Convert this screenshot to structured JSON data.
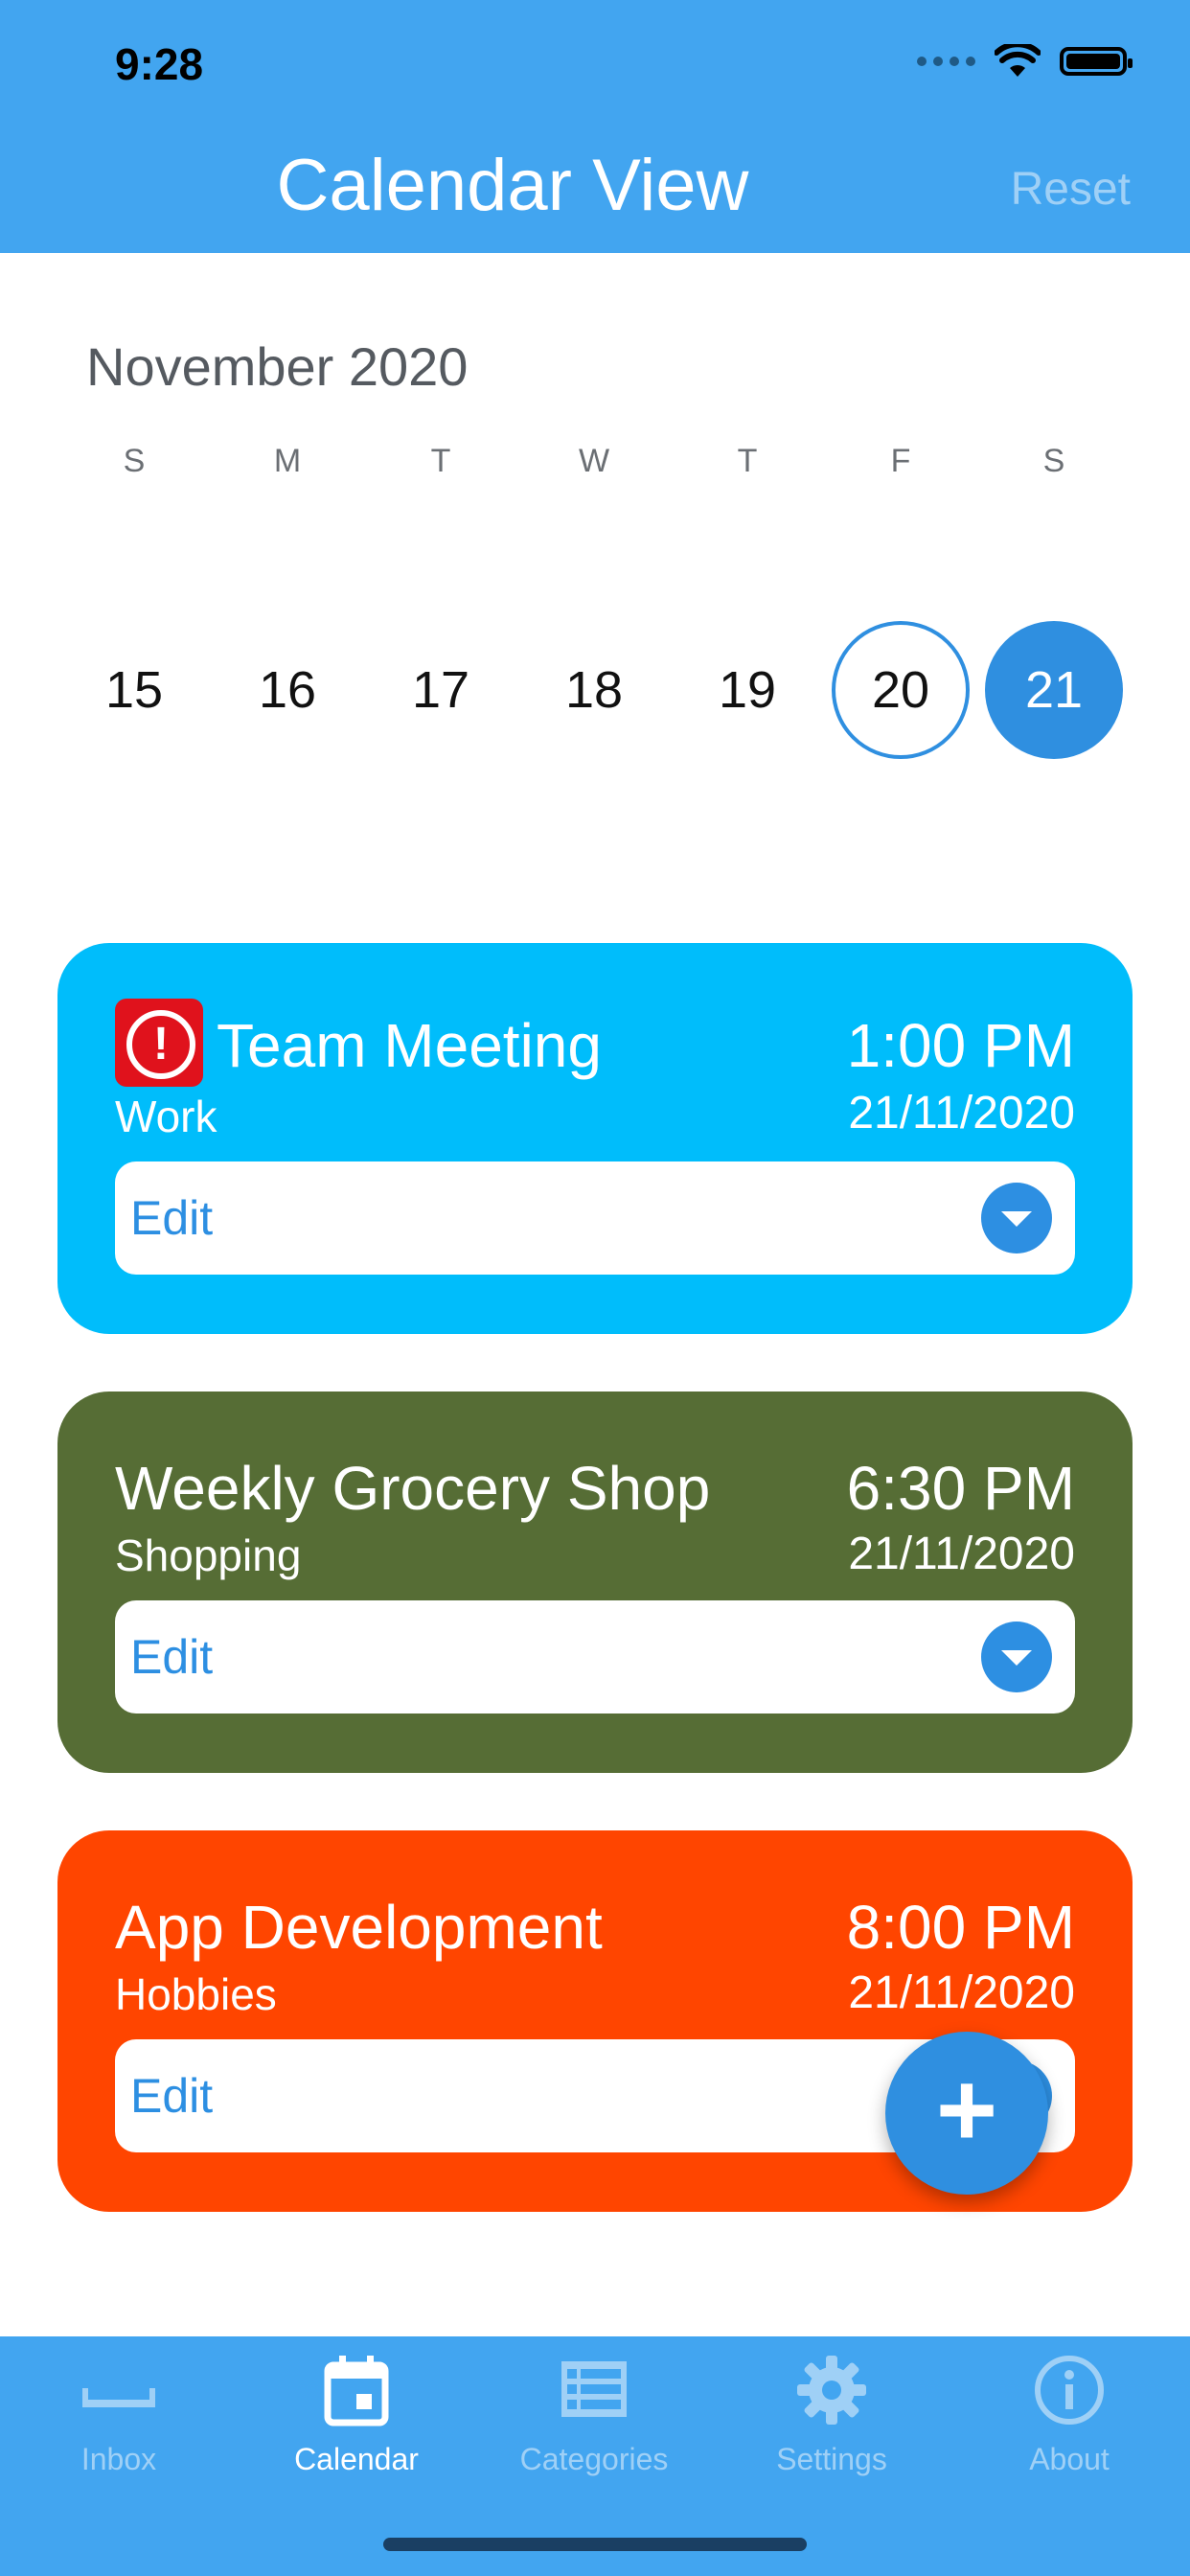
{
  "status_bar": {
    "time": "9:28"
  },
  "nav": {
    "title": "Calendar View",
    "reset": "Reset"
  },
  "calendar": {
    "month": "November 2020",
    "weekdays": [
      "S",
      "M",
      "T",
      "W",
      "T",
      "F",
      "S"
    ],
    "days": [
      "15",
      "16",
      "17",
      "18",
      "19",
      "20",
      "21"
    ],
    "today": "20",
    "selected": "21"
  },
  "events": [
    {
      "title": "Team Meeting",
      "category": "Work",
      "time": "1:00 PM",
      "date": "21/11/2020",
      "edit": "Edit",
      "color": "#00bdfb",
      "alert_icon": "exclamation-icon"
    },
    {
      "title": "Weekly Grocery Shop",
      "category": "Shopping",
      "time": "6:30 PM",
      "date": "21/11/2020",
      "edit": "Edit",
      "color": "#566d35"
    },
    {
      "title": "App Development",
      "category": "Hobbies",
      "time": "8:00 PM",
      "date": "21/11/2020",
      "edit": "Edit",
      "color": "#ff4500"
    }
  ],
  "fab": {
    "label": "+"
  },
  "tabs": [
    {
      "label": "Inbox",
      "icon": "inbox-icon",
      "active": false
    },
    {
      "label": "Calendar",
      "icon": "calendar-icon",
      "active": true
    },
    {
      "label": "Categories",
      "icon": "list-icon",
      "active": false
    },
    {
      "label": "Settings",
      "icon": "gear-icon",
      "active": false
    },
    {
      "label": "About",
      "icon": "info-icon",
      "active": false
    }
  ],
  "colors": {
    "accent": "#42a5f0",
    "primary_blue": "#2f8fe0"
  }
}
